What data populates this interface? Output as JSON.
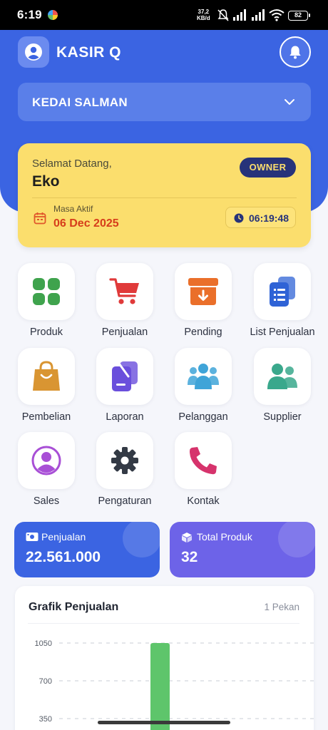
{
  "status_bar": {
    "time": "6:19",
    "network_speed": "37,2",
    "network_unit": "KB/d",
    "battery": "82"
  },
  "header": {
    "app_title": "KASIR Q",
    "store_name": "KEDAI SALMAN"
  },
  "welcome": {
    "greeting": "Selamat Datang,",
    "user_name": "Eko",
    "role": "OWNER",
    "active_label": "Masa Aktif",
    "active_date": "06 Dec 2025",
    "clock": "06:19:48"
  },
  "menu": [
    {
      "label": "Produk",
      "icon": "grid-icon",
      "color": "#3fa34d"
    },
    {
      "label": "Penjualan",
      "icon": "cart-icon",
      "color": "#e03a3a"
    },
    {
      "label": "Pending",
      "icon": "archive-icon",
      "color": "#ea6f2a"
    },
    {
      "label": "List Penjualan",
      "icon": "documents-icon",
      "color": "#2f63d6"
    },
    {
      "label": "Pembelian",
      "icon": "shopping-bag-icon",
      "color": "#d99532"
    },
    {
      "label": "Laporan",
      "icon": "report-icon",
      "color": "#6a4fdc"
    },
    {
      "label": "Pelanggan",
      "icon": "customers-icon",
      "color": "#3fa4d8"
    },
    {
      "label": "Supplier",
      "icon": "supplier-icon",
      "color": "#3aa88c"
    },
    {
      "label": "Sales",
      "icon": "user-circle-icon",
      "color": "#a84fd6"
    },
    {
      "label": "Pengaturan",
      "icon": "gear-icon",
      "color": "#333a45"
    },
    {
      "label": "Kontak",
      "icon": "phone-icon",
      "color": "#d6336c"
    }
  ],
  "stats": {
    "sales": {
      "label": "Penjualan",
      "value": "22.561.000",
      "color": "#3b64e2"
    },
    "products": {
      "label": "Total Produk",
      "value": "32",
      "color": "#6d63e8"
    }
  },
  "chart_data": {
    "type": "bar",
    "title": "Grafik Penjualan",
    "period": "1 Pekan",
    "y_ticks": [
      1050,
      700,
      350
    ],
    "ylim": [
      0,
      1050
    ],
    "grid": "dashed horizontal",
    "bar_color": "#5ec56b",
    "values": [
      1050
    ]
  }
}
